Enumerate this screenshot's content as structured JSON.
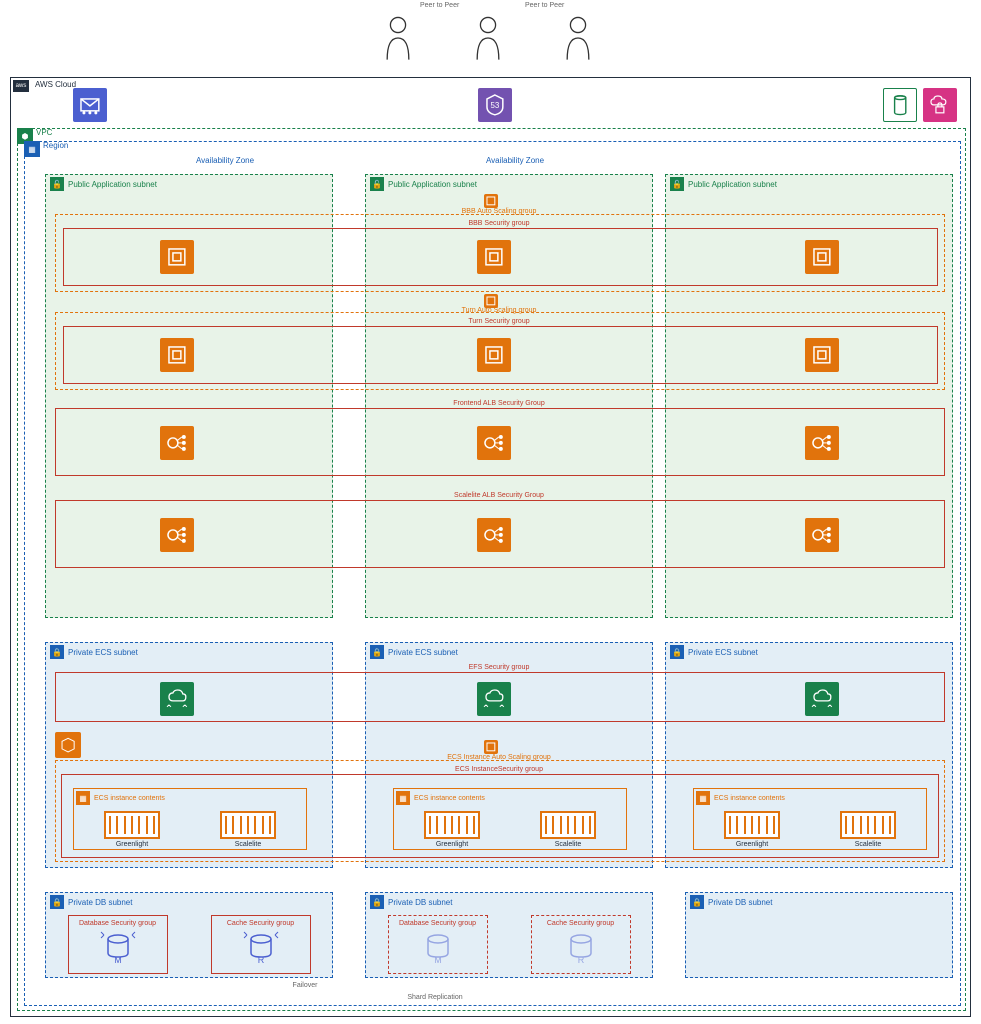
{
  "top": {
    "peer_to_peer": "Peer to Peer"
  },
  "cloud": {
    "label": "AWS Cloud",
    "vpc_label": "VPC",
    "region_label": "Region",
    "az_label": "Availability Zone"
  },
  "subnets": {
    "public_app": "Public Application subnet",
    "private_ecs": "Private ECS subnet",
    "private_db": "Private DB subnet"
  },
  "groups": {
    "bbb_asg": "BBB Auto Scaling group",
    "bbb_sg": "BBB Security group",
    "turn_asg": "Turn Auto Scaling group",
    "turn_sg": "Turn Security group",
    "frontend_alb_sg": "Frontend ALB Security Group",
    "scalelite_alb_sg": "Scalelite ALB Security Group",
    "efs_sg": "EFS Security group",
    "ecs_instance_asg": "ECS Instance Auto Scaling group",
    "ecs_instance_sg": "ECS InstanceSecurity group",
    "ecs_instance_contents": "ECS instance contents",
    "db_sg": "Database Security group",
    "cache_sg": "Cache Security group"
  },
  "containers": {
    "greenlight": "Greenlight",
    "scalelite": "Scalelite"
  },
  "bottom": {
    "failover": "Failover",
    "shard_replication": "Shard Replication"
  },
  "icons": {
    "ses": "ses-icon",
    "route53": "route53-icon",
    "s3": "s3-icon",
    "acm": "acm-icon",
    "ec2": "ec2-instance-icon",
    "elb": "elb-icon",
    "efs": "efs-icon",
    "ecs": "ecs-icon",
    "asg": "asg-icon",
    "rds": "rds-icon",
    "elasticache": "elasticache-icon",
    "user": "user-icon"
  }
}
